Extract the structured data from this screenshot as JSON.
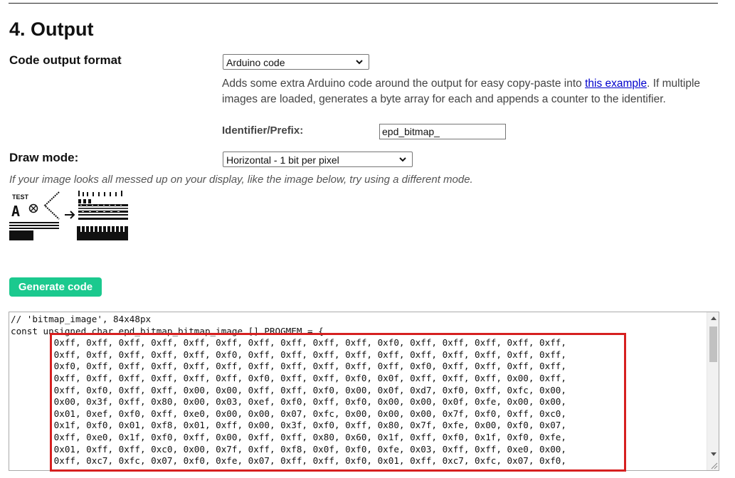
{
  "section": {
    "title": "4. Output"
  },
  "output_format": {
    "label": "Code output format",
    "selected": "Arduino code",
    "desc_before": "Adds some extra Arduino code around the output for easy copy-paste into ",
    "link": "this example",
    "desc_after": ". If multiple images are loaded, generates a byte array for each and appends a counter to the identifier.",
    "identifier_label": "Identifier/Prefix:",
    "identifier_value": "epd_bitmap_"
  },
  "draw_mode": {
    "label": "Draw mode:",
    "selected": "Horizontal - 1 bit per pixel",
    "hint": "If your image looks all messed up on your display, like the image below, try using a different mode."
  },
  "example": {
    "test_text": "TEST",
    "letter": "A"
  },
  "generate": {
    "label": "Generate code"
  },
  "code": {
    "lines": [
      "// 'bitmap_image', 84x48px",
      "const unsigned char epd_bitmap_bitmap_image [] PROGMEM = {",
      "        0xff, 0xff, 0xff, 0xff, 0xff, 0xff, 0xff, 0xff, 0xff, 0xff, 0xf0, 0xff, 0xff, 0xff, 0xff, 0xff,",
      "        0xff, 0xff, 0xff, 0xff, 0xff, 0xf0, 0xff, 0xff, 0xff, 0xff, 0xff, 0xff, 0xff, 0xff, 0xff, 0xff,",
      "        0xf0, 0xff, 0xff, 0xff, 0xff, 0xff, 0xff, 0xff, 0xff, 0xff, 0xff, 0xf0, 0xff, 0xff, 0xff, 0xff,",
      "        0xff, 0xff, 0xff, 0xff, 0xff, 0xff, 0xf0, 0xff, 0xff, 0xf0, 0x0f, 0xff, 0xff, 0xff, 0x00, 0xff,",
      "        0xff, 0xf0, 0xff, 0xff, 0x00, 0x00, 0xff, 0xff, 0xf0, 0x00, 0x0f, 0xd7, 0xf0, 0xff, 0xfc, 0x00,",
      "        0x00, 0x3f, 0xff, 0x80, 0x00, 0x03, 0xef, 0xf0, 0xff, 0xf0, 0x00, 0x00, 0x0f, 0xfe, 0x00, 0x00,",
      "        0x01, 0xef, 0xf0, 0xff, 0xe0, 0x00, 0x00, 0x07, 0xfc, 0x00, 0x00, 0x00, 0x7f, 0xf0, 0xff, 0xc0,",
      "        0x1f, 0xf0, 0x01, 0xf8, 0x01, 0xff, 0x00, 0x3f, 0xf0, 0xff, 0x80, 0x7f, 0xfe, 0x00, 0xf0, 0x07,",
      "        0xff, 0xe0, 0x1f, 0xf0, 0xff, 0x00, 0xff, 0xff, 0x80, 0x60, 0x1f, 0xff, 0xf0, 0x1f, 0xf0, 0xfe,",
      "        0x01, 0xff, 0xff, 0xc0, 0x00, 0x7f, 0xff, 0xf8, 0x0f, 0xf0, 0xfe, 0x03, 0xff, 0xff, 0xe0, 0x00,",
      "        0xff, 0xc7, 0xfc, 0x07, 0xf0, 0xfe, 0x07, 0xff, 0xff, 0xf0, 0x01, 0xff, 0xc7, 0xfc, 0x07, 0xf0,"
    ]
  },
  "colors": {
    "accent": "#1bc98e",
    "highlight": "#d62020",
    "link": "#0000cc"
  }
}
